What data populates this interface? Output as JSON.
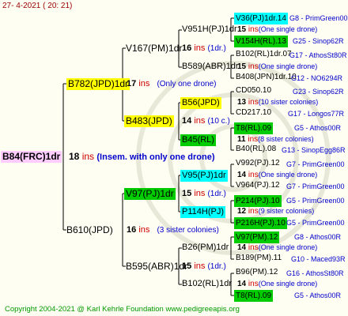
{
  "header": {
    "date": "27-   4-2021  ( 20: 21)"
  },
  "footer": {
    "copyright": "Copyright 2004-2021 @ Karl Kehrle Foundation     www.pedigreeapis.org"
  },
  "colors": {
    "pink": "#ffccff",
    "yellow": "#ffff00",
    "green": "#00cc00",
    "cyan": "#00ffff",
    "red": "#cc0000",
    "blue": "#0000cc"
  },
  "root": {
    "name": "B84(FRC)1dr",
    "ins_num": "18",
    "ins_text": "ins",
    "note": "(Insem. with only one drone)"
  },
  "l1": [
    {
      "name": "B782(JPD)1dr",
      "ins_num": "17",
      "ins_text": "ins",
      "note": "(Only one drone)"
    },
    {
      "name": "B610(JPD)",
      "ins_num": "16",
      "ins_text": "ins",
      "note": "(3 sister colonies)"
    }
  ],
  "l2": [
    {
      "name": "V167(PM)1dr",
      "ins_num": "16",
      "ins_text": "ins",
      "note": "(1dr.)"
    },
    {
      "name": "B483(JPD)",
      "ins_num": "14",
      "ins_text": "ins",
      "note": "(10 c.)"
    },
    {
      "name": "V97(PJ)1dr",
      "ins_num": "15",
      "ins_text": "ins",
      "note": "(1dr.)"
    },
    {
      "name": "B595(ABR)1dr",
      "ins_num": "15",
      "ins_text": "ins",
      "note": "(1dr.)"
    }
  ],
  "l3": [
    {
      "name": "V951H(PJ)1dr",
      "ins_num": "15",
      "ins_text": "ins",
      "note": "(One single drone)"
    },
    {
      "name": "B589(ABR)1dr",
      "ins_num": "15",
      "ins_text": "ins",
      "note": "(One single drone)"
    },
    {
      "name": "B56(JPD)",
      "ins_num": "13",
      "ins_text": "ins",
      "note": "(10 sister colonies)"
    },
    {
      "name": "B45(RL)",
      "ins_num": "11",
      "ins_text": "ins",
      "note": "(8 sister colonies)"
    },
    {
      "name": "V95(PJ)1dr",
      "ins_num": "14",
      "ins_text": "ins",
      "note": "(One single drone)"
    },
    {
      "name": "P114H(PJ)",
      "ins_num": "12",
      "ins_text": "ins",
      "note": "(9 sister colonies)"
    },
    {
      "name": "B26(PM)1dr",
      "ins_num": "14",
      "ins_text": "ins",
      "note": "(One single drone)"
    },
    {
      "name": "B102(RL)1dr",
      "ins_num": "14",
      "ins_text": "ins",
      "note": "(One single drone)"
    }
  ],
  "leaves": [
    {
      "name": "V36(PJ)1dr.14",
      "code": "G8 - PrimGreen00"
    },
    {
      "name": "V154H(RL).13",
      "code": "G25 - Sinop62R"
    },
    {
      "name": "B102(RL)1dr.07",
      "code": "G17 - AthosSt80R"
    },
    {
      "name": "B408(JPN)1dr.10",
      "code": "G12 - NO6294R"
    },
    {
      "name": "CD050.10",
      "code": "G23 - Sinop62R"
    },
    {
      "name": "CD217.10",
      "code": "G17 - Longos77R"
    },
    {
      "name": "T8(RL).09",
      "code": "G5 - Athos00R"
    },
    {
      "name": "B40(RL).08",
      "code": "G13 - SinopEgg86R"
    },
    {
      "name": "V992(PJ).12",
      "code": "G7 - PrimGreen00"
    },
    {
      "name": "V964(PJ).12",
      "code": "G7 - PrimGreen00"
    },
    {
      "name": "P214(PJ).10",
      "code": "G5 - PrimGreen00"
    },
    {
      "name": "P216H(PJ).10",
      "code": "G5 - PrimGreen00"
    },
    {
      "name": "V97(PM).12",
      "code": "G8 - Athos00R"
    },
    {
      "name": "B189(PM).11",
      "code": "G10 - Maced93R"
    },
    {
      "name": "B96(PM).12",
      "code": "G16 - AthosSt80R"
    },
    {
      "name": "T8(RL).09",
      "code": "G5 - Athos00R"
    }
  ]
}
